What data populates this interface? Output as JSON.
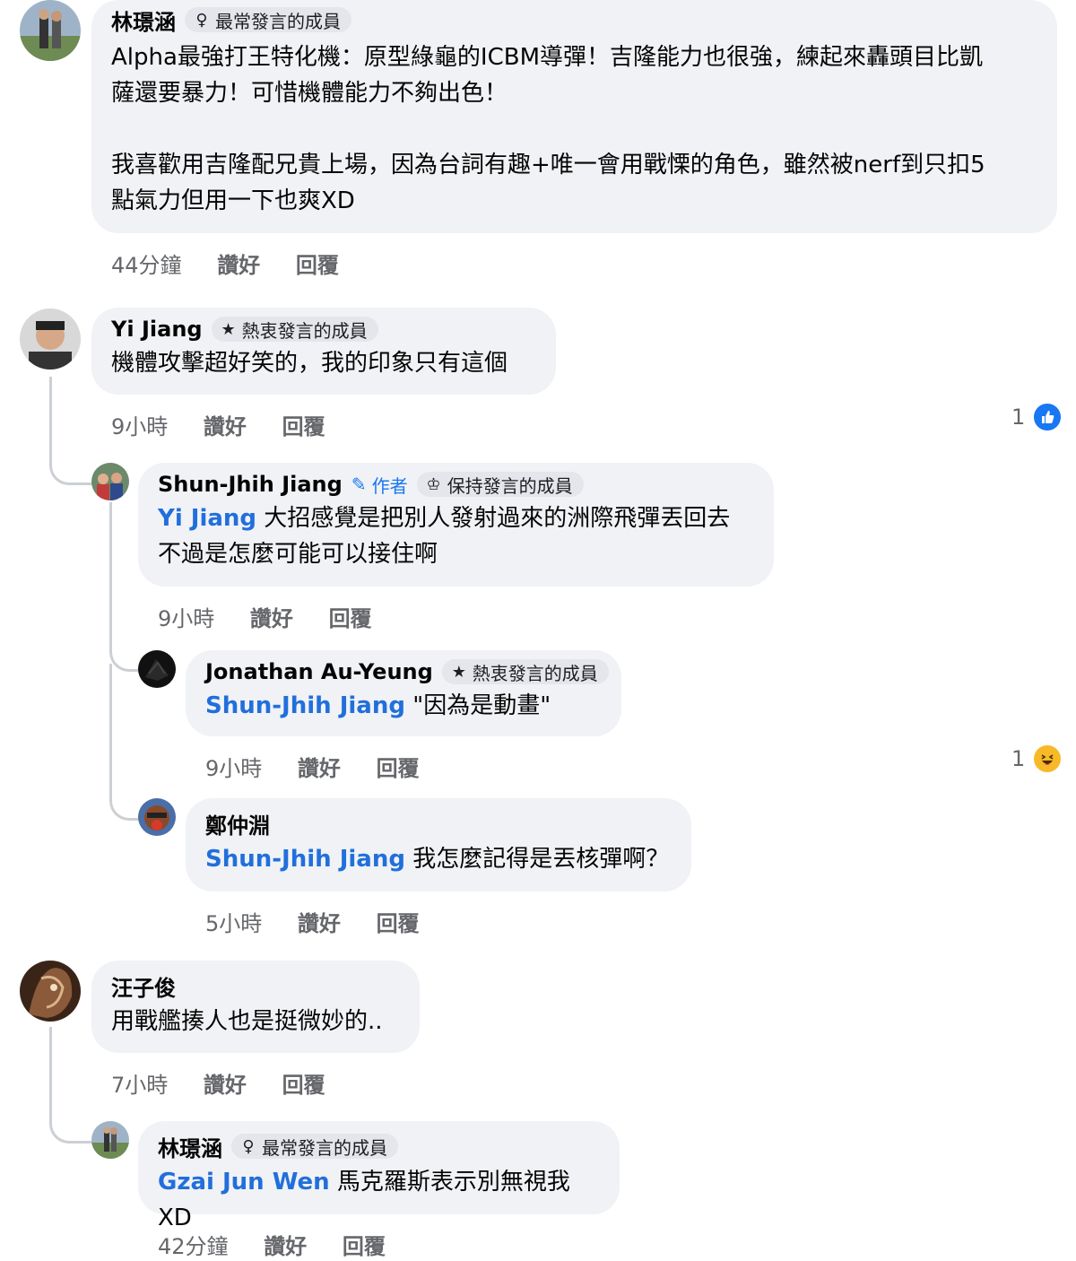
{
  "comments": [
    {
      "name": "林璟涵",
      "badge": "最常發言的成員",
      "badge_icon": "top-contributor-icon",
      "text": "Alpha最強打王特化機：原型綠龜的ICBM導彈！吉隆能力也很強，練起來轟頭目比凱\n薩還要暴力！可惜機體能力不夠出色！\n\n我喜歡用吉隆配兄貴上場，因為台詞有趣+唯一會用戰慄的角色，雖然被nerf到只扣5\n點氣力但用一下也爽XD",
      "time": "44分鐘",
      "like": "讚好",
      "reply": "回覆"
    },
    {
      "name": "Yi Jiang",
      "badge": "熱衷發言的成員",
      "badge_icon": "star-icon",
      "text": "機體攻擊超好笑的，我的印象只有這個",
      "time": "9小時",
      "like": "讚好",
      "reply": "回覆",
      "reaction_count": "1",
      "reaction_icon": "thumbs-up-icon"
    },
    {
      "name": "Shun-Jhih Jiang",
      "author": "作者",
      "badge": "保持發言的成員",
      "badge_icon": "trophy-icon",
      "mention": "Yi Jiang",
      "text": " 大招感覺是把別人發射過來的洲際飛彈丟回去\n不過是怎麼可能可以接住啊",
      "time": "9小時",
      "like": "讚好",
      "reply": "回覆"
    },
    {
      "name": "Jonathan Au-Yeung",
      "badge": "熱衷發言的成員",
      "badge_icon": "star-icon",
      "mention": "Shun-Jhih Jiang",
      "text": " \"因為是動畫\"",
      "time": "9小時",
      "like": "讚好",
      "reply": "回覆",
      "reaction_count": "1",
      "reaction_icon": "haha-icon"
    },
    {
      "name": "鄭仲淵",
      "mention": "Shun-Jhih Jiang",
      "text": " 我怎麼記得是丟核彈啊？",
      "time": "5小時",
      "like": "讚好",
      "reply": "回覆"
    },
    {
      "name": "汪子俊",
      "text": "用戰艦揍人也是挺微妙的..",
      "time": "7小時",
      "like": "讚好",
      "reply": "回覆"
    },
    {
      "name": "林璟涵",
      "badge": "最常發言的成員",
      "badge_icon": "top-contributor-icon",
      "mention": "Gzai Jun Wen",
      "text": " 馬克羅斯表示別無視我XD",
      "time": "42分鐘",
      "like": "讚好",
      "reply": "回覆"
    }
  ],
  "colors": {
    "bubble": "#f0f2f5",
    "mention": "#216fdb",
    "meta": "#65676b",
    "like_blue": "#1877f2",
    "haha_yellow": "#f7b928"
  }
}
